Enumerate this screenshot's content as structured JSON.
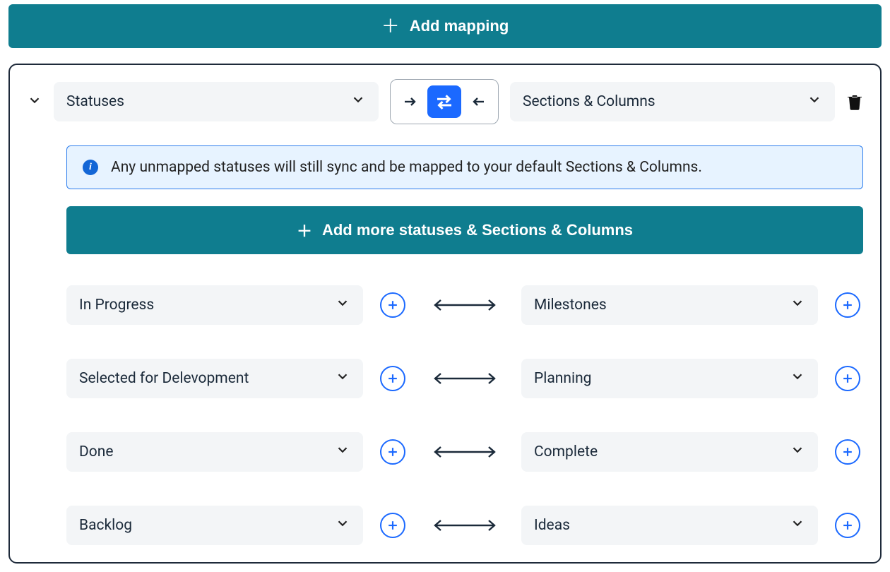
{
  "topButton": {
    "label": "Add mapping"
  },
  "card": {
    "leftField": "Statuses",
    "rightField": "Sections & Columns",
    "info": "Any unmapped statuses will still sync and be mapped to your default Sections & Columns.",
    "addMore": "Add more statuses & Sections & Columns",
    "rows": [
      {
        "left": "In Progress",
        "right": "Milestones"
      },
      {
        "left": "Selected for Delevopment",
        "right": "Planning"
      },
      {
        "left": "Done",
        "right": "Complete"
      },
      {
        "left": "Backlog",
        "right": "Ideas"
      }
    ]
  }
}
